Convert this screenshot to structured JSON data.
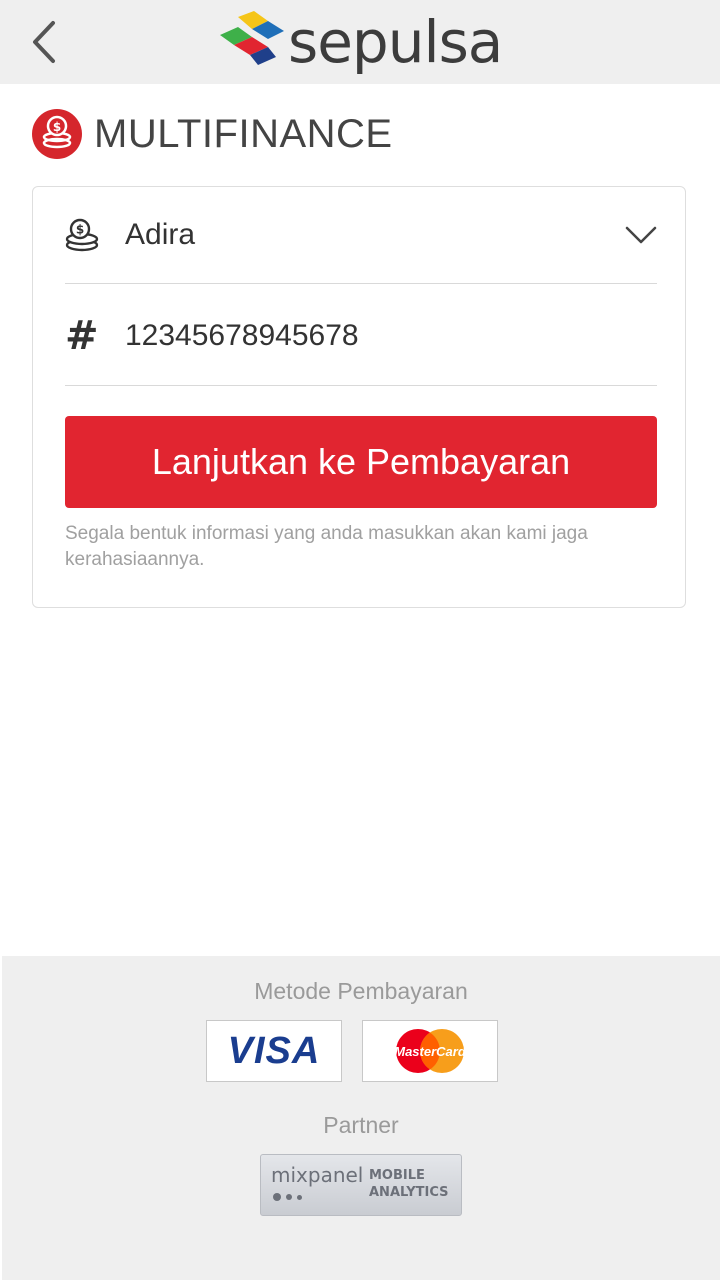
{
  "header": {
    "brand": "sepulsa"
  },
  "page": {
    "title": "MULTIFINANCE"
  },
  "form": {
    "provider_value": "Adira",
    "customer_number_value": "12345678945678",
    "submit_label": "Lanjutkan ke Pembayaran",
    "privacy_note": "Segala bentuk informasi yang anda masukkan akan kami jaga kerahasiaannya."
  },
  "footer": {
    "payment_heading": "Metode Pembayaran",
    "payment_methods": [
      "VISA",
      "MasterCard"
    ],
    "partner_heading": "Partner",
    "partner": {
      "name": "mixpanel",
      "tagline_line1": "MOBILE",
      "tagline_line2": "ANALYTICS"
    }
  },
  "icons": {
    "back": "chevron-left-icon",
    "category": "coins-icon",
    "provider": "coins-stack-icon",
    "number": "hash-icon",
    "dropdown": "chevron-down-icon"
  },
  "colors": {
    "accent": "#e12530",
    "topbar": "#efefef",
    "footer": "#efefef",
    "visa": "#1a3d8f",
    "mastercard_red": "#eb001b",
    "mastercard_orange": "#f79e1b"
  }
}
